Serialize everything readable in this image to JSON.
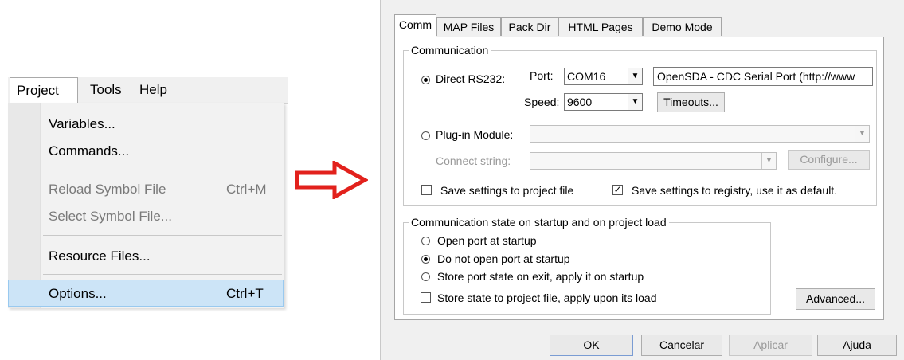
{
  "menu": {
    "bar": [
      "Project",
      "Tools",
      "Help"
    ],
    "items": [
      {
        "label": "Variables...",
        "shortcut": ""
      },
      {
        "label": "Commands...",
        "shortcut": ""
      },
      {
        "label": "Reload Symbol File",
        "shortcut": "Ctrl+M"
      },
      {
        "label": "Select Symbol File...",
        "shortcut": ""
      },
      {
        "label": "Resource Files...",
        "shortcut": ""
      },
      {
        "label": "Options...",
        "shortcut": "Ctrl+T"
      }
    ]
  },
  "arrow": {
    "color": "#e2211c",
    "icon": "right-arrow-icon"
  },
  "dialog": {
    "tabs": [
      "Comm",
      "MAP Files",
      "Pack Dir",
      "HTML Pages",
      "Demo Mode"
    ],
    "communication": {
      "title": "Communication",
      "direct_rs232": "Direct RS232:",
      "port_label": "Port:",
      "port_value": "COM16",
      "port_description": "OpenSDA - CDC Serial Port (http://www",
      "speed_label": "Speed:",
      "speed_value": "9600",
      "timeouts": "Timeouts...",
      "plugin_module": "Plug-in Module:",
      "connect_string": "Connect string:",
      "configure": "Configure...",
      "save_project": "Save settings to project file",
      "save_registry": "Save settings to registry, use it as default."
    },
    "startup": {
      "title": "Communication state on startup and on project load",
      "open_port": "Open port at startup",
      "do_not_open": "Do not open port at startup",
      "store_port": "Store port state on exit, apply it on startup",
      "store_project": "Store state to project file, apply upon its load"
    },
    "advanced": "Advanced...",
    "buttons": {
      "ok": "OK",
      "cancel": "Cancelar",
      "apply": "Aplicar",
      "help": "Ajuda"
    }
  }
}
